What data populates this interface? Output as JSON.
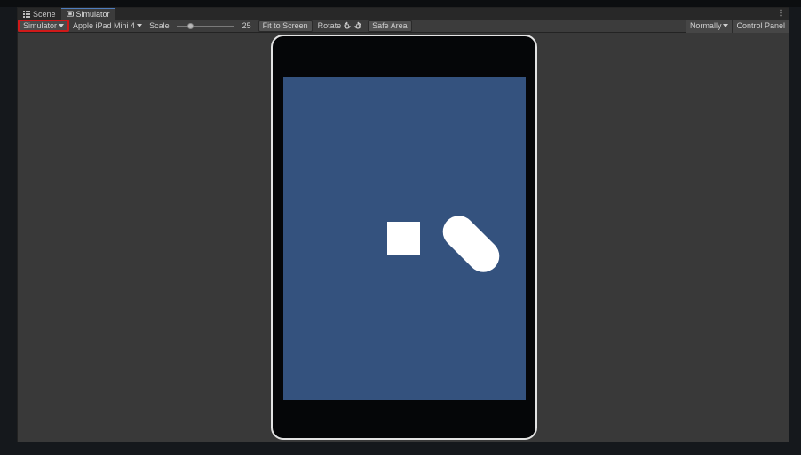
{
  "tabs": [
    {
      "label": "Scene",
      "icon": "grid-icon"
    },
    {
      "label": "Simulator",
      "icon": "device-icon"
    }
  ],
  "toolbar": {
    "mode_dropdown": "Simulator",
    "device_dropdown": "Apple iPad Mini 4",
    "scale_label": "Scale",
    "scale_value": "25",
    "scale_fraction": 0.21,
    "fit_to_screen": "Fit to Screen",
    "rotate_label": "Rotate",
    "safe_area": "Safe Area",
    "normally_dropdown": "Normally",
    "control_panel": "Control Panel"
  },
  "colors": {
    "editor_background": "#383838",
    "toolbar_background": "#3c3c3c",
    "device_screen": "#34527e",
    "device_bezel": "#050608",
    "highlight": "#d01919",
    "sprite": "#ffffff"
  },
  "scene": {
    "sprites": [
      {
        "shape": "square",
        "color": "#ffffff"
      },
      {
        "shape": "capsule",
        "color": "#ffffff",
        "rotation_deg": 45
      }
    ]
  }
}
